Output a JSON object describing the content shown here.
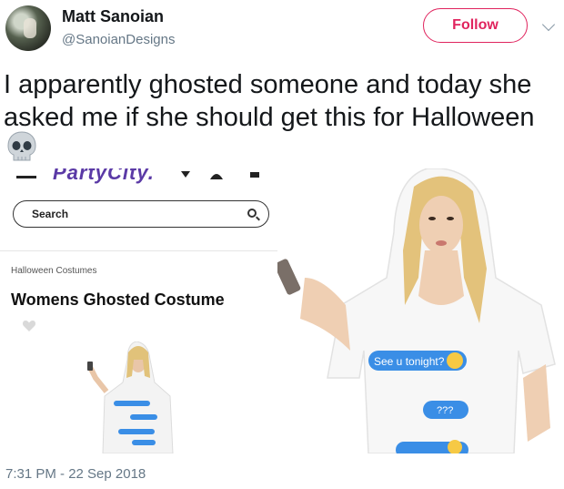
{
  "tweet": {
    "display_name": "Matt Sanoian",
    "handle": "@SanoianDesigns",
    "follow_label": "Follow",
    "text": "I apparently ghosted someone and today she asked me if she should get this for Halloween",
    "emoji_icon": "skull-icon",
    "timestamp": "7:31 PM - 22 Sep 2018"
  },
  "embedded_page": {
    "logo": "PartyCity.",
    "search_placeholder": "Search",
    "breadcrumb": "Halloween Costumes",
    "product_title": "Womens Ghosted Costume",
    "bubble_texts": [
      "See u tonight?",
      "???"
    ]
  },
  "colors": {
    "follow_accent": "#e0245e",
    "secondary_text": "#657786",
    "bubble_blue": "#3a8ee6"
  }
}
